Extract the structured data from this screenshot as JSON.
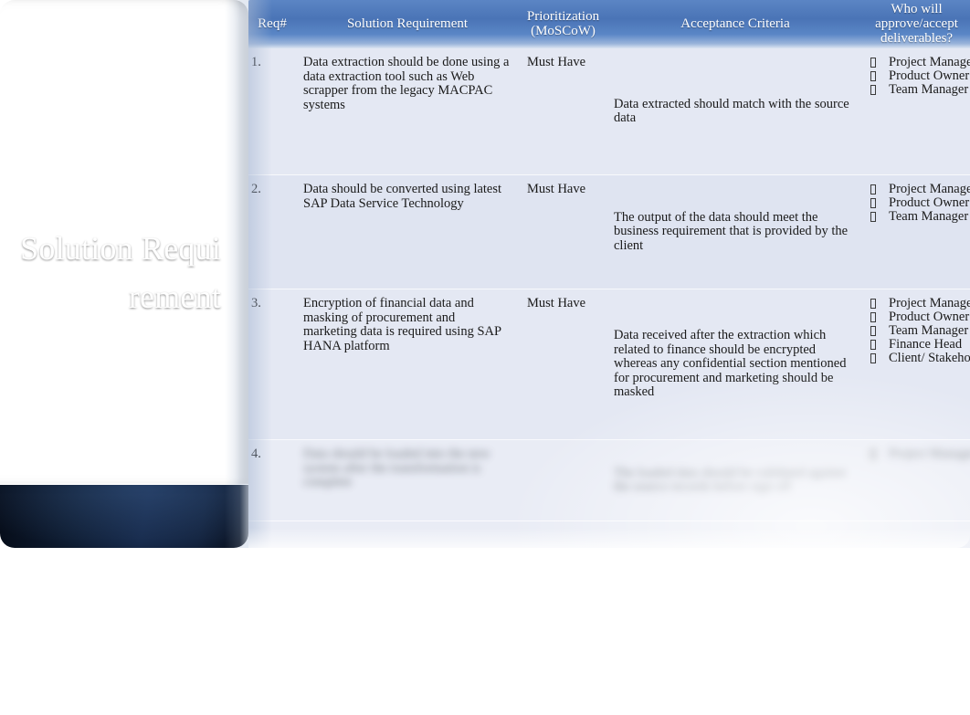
{
  "slide": {
    "title": "Solution Requirement",
    "accent_color": "#4a74b6",
    "panel_color": "#1d3a62",
    "table_bg_color": "#e4e8f3"
  },
  "table": {
    "headers": {
      "req": "Req#",
      "solution": "Solution Requirement",
      "prioritization_line1": "Prioritization",
      "prioritization_line2": "(MoSCoW)",
      "acceptance": "Acceptance Criteria",
      "who_line1": "Who will",
      "who_line2": "approve/accept",
      "who_line3": "deliverables?"
    },
    "rows": [
      {
        "num": "1.",
        "requirement": "Data extraction should be done using a data extraction tool such as Web scrapper from the legacy MACPAC systems",
        "priority": "Must Have",
        "acceptance": "Data extracted should match with the source data",
        "approvers": [
          "Project Manager",
          "Product Owner",
          "Team Manager"
        ],
        "redacted": false
      },
      {
        "num": "2.",
        "requirement": "Data should be converted using latest SAP Data Service Technology",
        "priority": "Must Have",
        "acceptance": "The output of the data should meet the business requirement that is provided by the client",
        "approvers": [
          "Project Manager",
          "Product Owner",
          "Team Manager"
        ],
        "redacted": false
      },
      {
        "num": "3.",
        "requirement": "Encryption of financial data and masking of procurement and marketing data is required using SAP HANA platform",
        "priority": "Must Have",
        "acceptance": "Data received after the extraction which related to finance should be encrypted whereas any confidential section mentioned for procurement and marketing should be masked",
        "approvers": [
          "Project Manager",
          "Product Owner",
          "Team Manager",
          "Finance Head",
          "Client/ Stakeholder"
        ],
        "redacted": false
      },
      {
        "num": "4.",
        "requirement": "Data should be loaded into the new system after the transformation is complete",
        "priority": "",
        "acceptance": "The loaded data should be validated against the source records before sign off",
        "approvers": [
          "Project Manager"
        ],
        "redacted": true
      },
      {
        "num": "",
        "requirement": "",
        "priority": "",
        "acceptance": "",
        "approvers": [],
        "redacted": false
      }
    ]
  }
}
